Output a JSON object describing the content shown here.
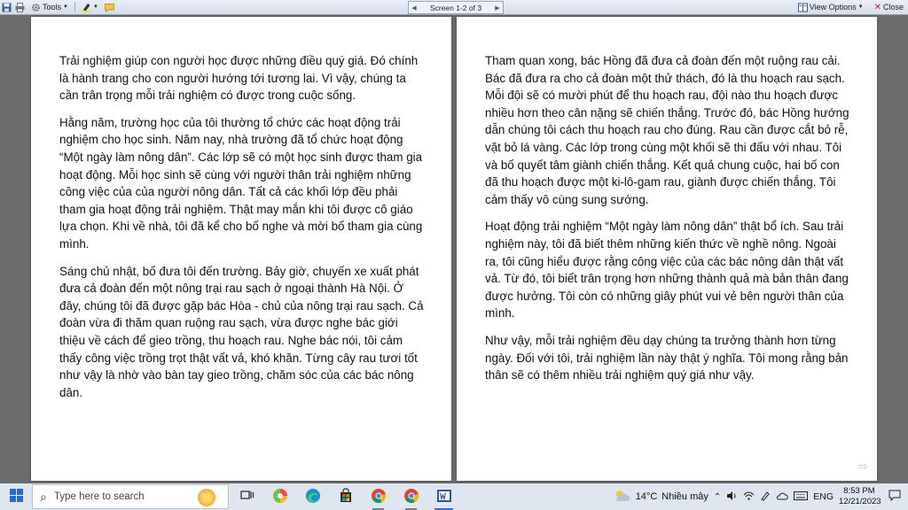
{
  "toolbar": {
    "tools_label": "Tools",
    "screen_label": "Screen 1-2 of 3",
    "view_options_label": "View Options",
    "close_label": "Close"
  },
  "pages": {
    "left": [
      "Trải nghiệm giúp con người học được những điều quý giá. Đó chính là hành trang cho con người hướng tới tương lai. Vì vậy, chúng ta cần trân trọng mỗi trải nghiệm có được trong cuộc sống.",
      "Hằng năm, trường học của tôi thường tổ chức các hoạt động trải nghiệm cho học sinh. Năm nay, nhà trường đã tổ chức hoạt động “Một ngày làm nông dân”. Các lớp sẽ có một học sinh được tham gia hoạt động. Mỗi học sinh sẽ cùng với người thân trải nghiệm những công việc của của người nông dân. Tất cả các khối lớp đều phải tham gia hoạt động trải nghiệm. Thật may mắn khi tôi được cô giáo lựa chọn. Khi về nhà, tôi đã kể cho bố nghe và mời bố tham gia cùng mình.",
      "Sáng chủ nhật, bố đưa tôi đến trường. Bảy giờ, chuyến xe xuất phát đưa cả đoàn đến một nông trại rau sạch ở ngoại thành Hà Nội. Ở đây, chúng tôi đã được gặp bác Hòa - chủ của nông trại rau sạch. Cả đoàn vừa đi thăm quan ruộng rau sạch, vừa được nghe bác giới thiệu về cách để gieo trồng, thu hoạch rau. Nghe bác nói, tôi cảm thấy công việc trồng trọt thật vất vả, khó khăn. Từng cây rau tươi tốt như vậy là nhờ vào bàn tay gieo trồng, chăm sóc của các bác nông dân."
    ],
    "right": [
      "Tham quan xong, bác Hồng đã đưa cả đoàn đến một ruộng rau cải. Bác đã đưa ra cho cả đoàn một thử thách, đó là thu hoạch rau sạch. Mỗi đội sẽ có mười phút để thu hoạch rau, đội nào thu hoạch được nhiều hơn theo cân nặng sẽ chiến thắng. Trước đó, bác Hồng hướng dẫn chúng tôi cách thu hoạch rau cho đúng. Rau cần được cắt bỏ rễ, vặt bỏ lá vàng. Các lớp trong cùng một khối sẽ thi đấu với nhau. Tôi và bố quyết tâm giành chiến thắng. Kết quả chung cuộc, hai bố con đã thu hoạch được một ki-lô-gam rau, giành được chiến thắng. Tôi cảm thấy vô cùng sung sướng.",
      "Hoạt động trải nghiệm “Một ngày làm nông dân” thật bổ ích. Sau trải nghiệm này, tôi đã biết thêm những kiến thức về nghề nông. Ngoài ra, tôi cũng hiểu được rằng công việc của các bác nông dân thật vất vả. Từ đó, tôi biết trân trọng hơn những thành quả mà bản thân đang được hưởng. Tôi còn có những giây phút vui vẻ bên người thân của mình.",
      "Như vậy, mỗi trải nghiệm đều dạy chúng ta trưởng thành hơn từng ngày. Đối với tôi, trải nghiệm lần này thật ý nghĩa. Tôi mong rằng bản thân sẽ có thêm nhiều trải nghiệm quý giá như vậy."
    ]
  },
  "taskbar": {
    "search_placeholder": "Type here to search",
    "temperature": "14°C",
    "weather_text": "Nhiều mây",
    "language": "ENG",
    "time": "8:53 PM",
    "date": "12/21/2023"
  },
  "colors": {
    "toolbar_bg": "#dfe6f0",
    "reading_bg": "#6b6b6b",
    "page_bg": "#ffffff",
    "accent": "#2c6ed1"
  }
}
